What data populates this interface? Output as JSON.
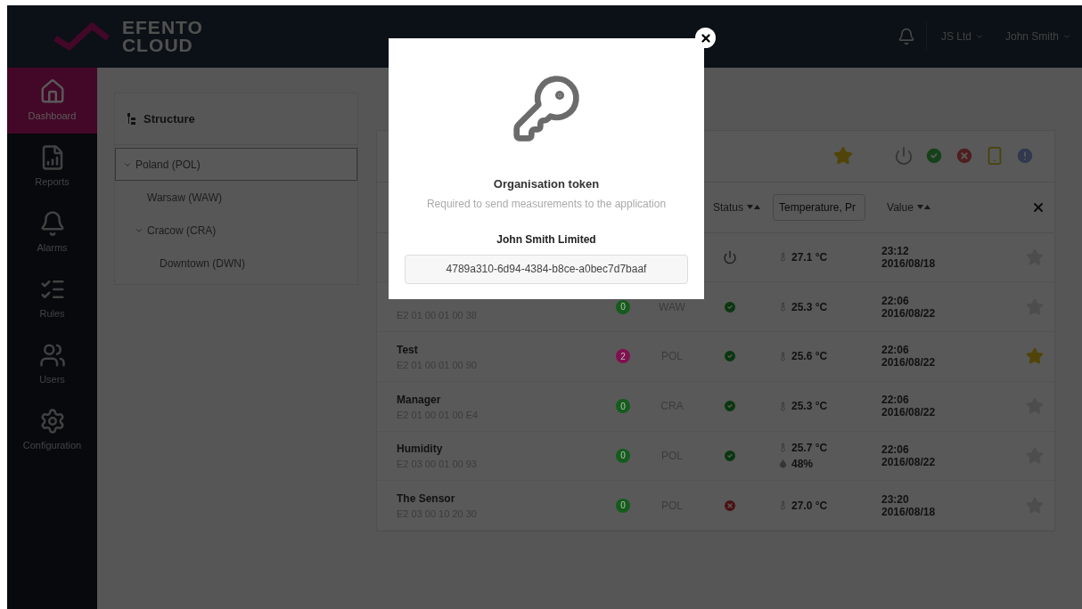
{
  "header": {
    "logo_line1": "EFENTO",
    "logo_line2": "CLOUD",
    "organisation": "JS Ltd",
    "user": "John Smith"
  },
  "nav": [
    {
      "label": "Dashboard",
      "selected": true
    },
    {
      "label": "Reports",
      "selected": false
    },
    {
      "label": "Alarms",
      "selected": false
    },
    {
      "label": "Rules",
      "selected": false
    },
    {
      "label": "Users",
      "selected": false
    },
    {
      "label": "Configuration",
      "selected": false
    }
  ],
  "structure": {
    "title": "Structure",
    "tree": [
      {
        "label": "Poland (POL)",
        "expanded": true,
        "selected": true,
        "children": [
          {
            "label": "Warsaw (WAW)",
            "selected": false
          },
          {
            "label": "Cracow (CRA)",
            "expanded": true,
            "selected": false,
            "children": [
              {
                "label": "Downtown (DWN)",
                "selected": false
              }
            ]
          }
        ]
      }
    ]
  },
  "filters": [
    {
      "kind": "star"
    },
    {
      "kind": "power"
    },
    {
      "kind": "ok"
    },
    {
      "kind": "error"
    },
    {
      "kind": "phone"
    },
    {
      "kind": "alert"
    }
  ],
  "table": {
    "columns": [
      {
        "label": "Status",
        "kind": "sort"
      },
      {
        "placeholder": "Temperature, Pr",
        "kind": "filter"
      },
      {
        "label": "Value",
        "kind": "sort"
      }
    ],
    "rows": [
      {
        "kind": "power",
        "measurements": [
          {
            "kind": "temperature",
            "value": "27.1 °C"
          }
        ],
        "time": "23:12",
        "date": "2016/08/18",
        "favorite": false
      },
      {
        "serial": "E2 01 00 01 00 38",
        "count": "0",
        "color": "#155c1c",
        "location": "WAW",
        "kind": "ok",
        "measurements": [
          {
            "kind": "temperature",
            "value": "25.3 °C"
          }
        ],
        "time": "22:06",
        "date": "2016/08/22",
        "favorite": false
      },
      {
        "name": "Test",
        "serial": "E2 01 00 01 00 90",
        "count": "2",
        "color": "#80104f",
        "location": "POL",
        "kind": "ok",
        "measurements": [
          {
            "kind": "temperature",
            "value": "25.6 °C"
          }
        ],
        "time": "22:06",
        "date": "2016/08/22",
        "favorite": true
      },
      {
        "name": "Manager",
        "serial": "E2 01 00 01 00 E4",
        "count": "0",
        "color": "#155c1c",
        "location": "CRA",
        "kind": "ok",
        "measurements": [
          {
            "kind": "temperature",
            "value": "25.3 °C"
          }
        ],
        "time": "22:06",
        "date": "2016/08/22",
        "favorite": false
      },
      {
        "name": "Humidity",
        "serial": "E2 03 00 01 00 93",
        "count": "0",
        "color": "#155c1c",
        "location": "POL",
        "kind": "ok",
        "measurements": [
          {
            "kind": "temperature",
            "value": "25.7 °C"
          },
          {
            "kind": "humidity",
            "value": "48%"
          }
        ],
        "time": "22:06",
        "date": "2016/08/22",
        "favorite": false
      },
      {
        "name": "The Sensor",
        "serial": "E2 03 00 10 20 30",
        "count": "0",
        "color": "#155c1c",
        "location": "POL",
        "kind": "error",
        "measurements": [
          {
            "kind": "temperature",
            "value": "27.0 °C"
          }
        ],
        "time": "23:20",
        "date": "2016/08/18",
        "favorite": false
      }
    ]
  },
  "modal": {
    "title": "Organisation token",
    "subtitle": "Required to send measurements to the application",
    "organisation": "John Smith Limited",
    "token": "4789a310-6d94-4384-b8ce-a0bec7d7baaf"
  }
}
